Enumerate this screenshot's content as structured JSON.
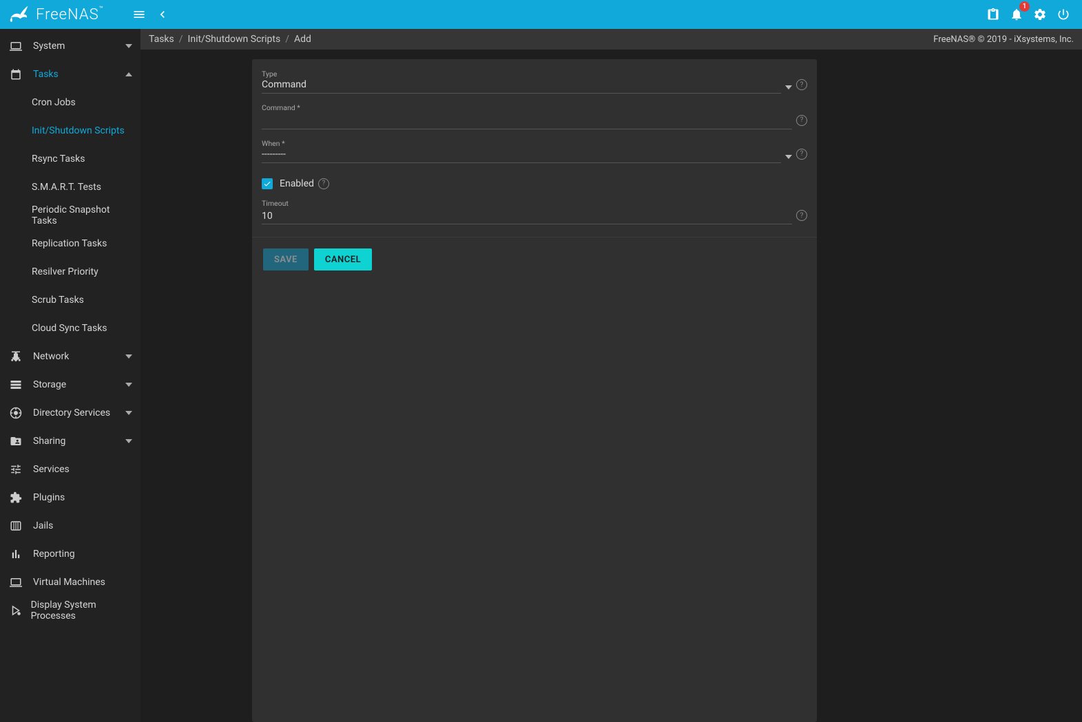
{
  "brand": "FreeNAS",
  "topbar": {
    "notif_count": "1"
  },
  "breadcrumb": {
    "a": "Tasks",
    "b": "Init/Shutdown Scripts",
    "c": "Add",
    "right": "FreeNAS® © 2019 - iXsystems, Inc."
  },
  "sidebar": {
    "items": [
      {
        "label": "System",
        "icon": "laptop",
        "expandable": true
      },
      {
        "label": "Tasks",
        "icon": "calendar",
        "expandable": true,
        "active": true,
        "expanded": true,
        "children": [
          {
            "label": "Cron Jobs"
          },
          {
            "label": "Init/Shutdown Scripts",
            "active": true
          },
          {
            "label": "Rsync Tasks"
          },
          {
            "label": "S.M.A.R.T. Tests"
          },
          {
            "label": "Periodic Snapshot Tasks"
          },
          {
            "label": "Replication Tasks"
          },
          {
            "label": "Resilver Priority"
          },
          {
            "label": "Scrub Tasks"
          },
          {
            "label": "Cloud Sync Tasks"
          }
        ]
      },
      {
        "label": "Network",
        "icon": "share",
        "expandable": true
      },
      {
        "label": "Storage",
        "icon": "storage",
        "expandable": true
      },
      {
        "label": "Directory Services",
        "icon": "help",
        "expandable": true
      },
      {
        "label": "Sharing",
        "icon": "folder-shared",
        "expandable": true
      },
      {
        "label": "Services",
        "icon": "tune"
      },
      {
        "label": "Plugins",
        "icon": "extension"
      },
      {
        "label": "Jails",
        "icon": "jail"
      },
      {
        "label": "Reporting",
        "icon": "bar-chart"
      },
      {
        "label": "Virtual Machines",
        "icon": "laptop"
      },
      {
        "label": "Display System Processes",
        "icon": "processes"
      }
    ]
  },
  "form": {
    "type": {
      "label": "Type",
      "value": "Command"
    },
    "command": {
      "label": "Command *",
      "value": ""
    },
    "when": {
      "label": "When *",
      "value": "---------"
    },
    "enabled": {
      "label": "Enabled",
      "checked": true
    },
    "timeout": {
      "label": "Timeout",
      "value": "10"
    },
    "save": "SAVE",
    "cancel": "CANCEL"
  }
}
